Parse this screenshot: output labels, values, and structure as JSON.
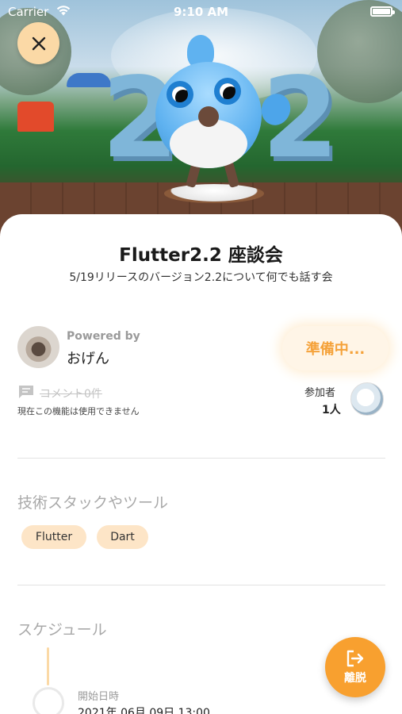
{
  "status_bar": {
    "carrier": "Carrier",
    "time": "9:10 AM"
  },
  "event": {
    "title": "Flutter2.2 座談会",
    "subtitle": "5/19リリースのバージョン2.2について何でも話す会"
  },
  "owner": {
    "powered_by_label": "Powered by",
    "name": "おげん"
  },
  "status_pill": {
    "label": "準備中..."
  },
  "comments": {
    "count_label": "コメント0件",
    "note": "現在この機能は使用できません"
  },
  "participants": {
    "label": "参加者",
    "count": "1人"
  },
  "tech_stack": {
    "title": "技術スタックやツール",
    "tags": [
      "Flutter",
      "Dart"
    ]
  },
  "schedule": {
    "title": "スケジュール",
    "start_label": "開始日時",
    "start_value": "2021年 06月 09日 13:00"
  },
  "leave_button": {
    "label": "離脱"
  },
  "colors": {
    "accent": "#f8a02f",
    "accent_light": "#fbd9a6",
    "tag_bg": "#fde5c7"
  },
  "icons": {
    "close": "close-icon",
    "comment": "comment-icon",
    "leave": "logout-icon",
    "wifi": "wifi-icon",
    "battery": "battery-icon"
  }
}
